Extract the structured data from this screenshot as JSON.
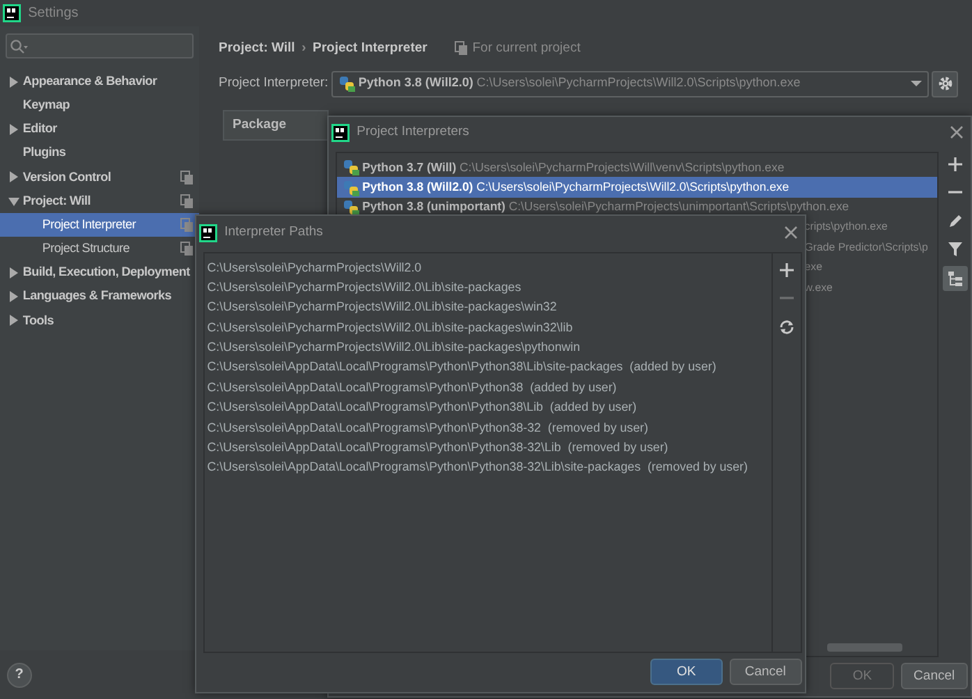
{
  "window": {
    "title": "Settings"
  },
  "sidebar": {
    "items": [
      {
        "label": "Appearance & Behavior",
        "expandable": true,
        "expanded": false,
        "selected": false,
        "shared": false
      },
      {
        "label": "Keymap",
        "expandable": false,
        "selected": false,
        "shared": false
      },
      {
        "label": "Editor",
        "expandable": true,
        "expanded": false,
        "selected": false,
        "shared": false
      },
      {
        "label": "Plugins",
        "expandable": false,
        "selected": false,
        "shared": false
      },
      {
        "label": "Version Control",
        "expandable": true,
        "expanded": false,
        "selected": false,
        "shared": true
      },
      {
        "label": "Project: Will",
        "expandable": true,
        "expanded": true,
        "selected": false,
        "shared": true,
        "children": [
          {
            "label": "Project Interpreter",
            "expandable": false,
            "selected": true,
            "shared": true
          },
          {
            "label": "Project Structure",
            "expandable": false,
            "selected": false,
            "shared": true
          }
        ]
      },
      {
        "label": "Build, Execution, Deployment",
        "expandable": true,
        "expanded": false,
        "selected": false,
        "shared": false
      },
      {
        "label": "Languages & Frameworks",
        "expandable": true,
        "expanded": false,
        "selected": false,
        "shared": false
      },
      {
        "label": "Tools",
        "expandable": true,
        "expanded": false,
        "selected": false,
        "shared": false
      }
    ]
  },
  "breadcrumb": {
    "items": [
      "Project: Will",
      "Project Interpreter"
    ],
    "separator": "›",
    "scope_note": "For current project"
  },
  "interpreter_field": {
    "label": "Project Interpreter:",
    "name": "Python 3.8 (Will2.0)",
    "path": "C:\\Users\\solei\\PycharmProjects\\Will2.0\\Scripts\\python.exe"
  },
  "package_table": {
    "columns": [
      "Package"
    ]
  },
  "interpreters_dialog": {
    "title": "Project Interpreters",
    "rows": [
      {
        "kind": "full",
        "name": "Python 3.7 (Will)",
        "path": "C:\\Users\\solei\\PycharmProjects\\Will\\venv\\Scripts\\python.exe",
        "selected": false
      },
      {
        "kind": "full",
        "name": "Python 3.8 (Will2.0)",
        "path": "C:\\Users\\solei\\PycharmProjects\\Will2.0\\Scripts\\python.exe",
        "selected": true
      },
      {
        "kind": "full",
        "name": "Python 3.8 (unimportant)",
        "path": "C:\\Users\\solei\\PycharmProjects\\unimportant\\Scripts\\python.exe",
        "selected": false
      },
      {
        "kind": "partial",
        "path": "cripts\\python.exe",
        "selected": false
      },
      {
        "kind": "partial",
        "path": "Grade Predictor\\Scripts\\p",
        "selected": false
      },
      {
        "kind": "partial",
        "path": "exe",
        "selected": false
      },
      {
        "kind": "partial",
        "path": "w.exe",
        "selected": false
      }
    ],
    "tools": [
      {
        "kind": "add",
        "selected": false
      },
      {
        "kind": "remove",
        "selected": false
      },
      {
        "kind": "edit",
        "selected": false
      },
      {
        "kind": "filter",
        "selected": false
      },
      {
        "kind": "paths",
        "selected": true
      }
    ],
    "buttons": [
      {
        "label": "OK",
        "disabled": true
      },
      {
        "label": "Cancel",
        "disabled": false
      }
    ]
  },
  "paths_dialog": {
    "title": "Interpreter Paths",
    "paths": [
      "C:\\Users\\solei\\PycharmProjects\\Will2.0",
      "C:\\Users\\solei\\PycharmProjects\\Will2.0\\Lib\\site-packages",
      "C:\\Users\\solei\\PycharmProjects\\Will2.0\\Lib\\site-packages\\win32",
      "C:\\Users\\solei\\PycharmProjects\\Will2.0\\Lib\\site-packages\\win32\\lib",
      "C:\\Users\\solei\\PycharmProjects\\Will2.0\\Lib\\site-packages\\pythonwin",
      "C:\\Users\\solei\\AppData\\Local\\Programs\\Python\\Python38\\Lib\\site-packages  (added by user)",
      "C:\\Users\\solei\\AppData\\Local\\Programs\\Python\\Python38  (added by user)",
      "C:\\Users\\solei\\AppData\\Local\\Programs\\Python\\Python38\\Lib  (added by user)",
      "C:\\Users\\solei\\AppData\\Local\\Programs\\Python\\Python38-32  (removed by user)",
      "C:\\Users\\solei\\AppData\\Local\\Programs\\Python\\Python38-32\\Lib  (removed by user)",
      "C:\\Users\\solei\\AppData\\Local\\Programs\\Python\\Python38-32\\Lib\\site-packages  (removed by user)"
    ],
    "tools": [
      {
        "kind": "add",
        "disabled": false
      },
      {
        "kind": "remove",
        "disabled": true
      },
      {
        "kind": "refresh",
        "disabled": false
      }
    ],
    "buttons": [
      {
        "label": "OK",
        "default": true
      },
      {
        "label": "Cancel",
        "default": false
      }
    ]
  },
  "help_button": "?"
}
